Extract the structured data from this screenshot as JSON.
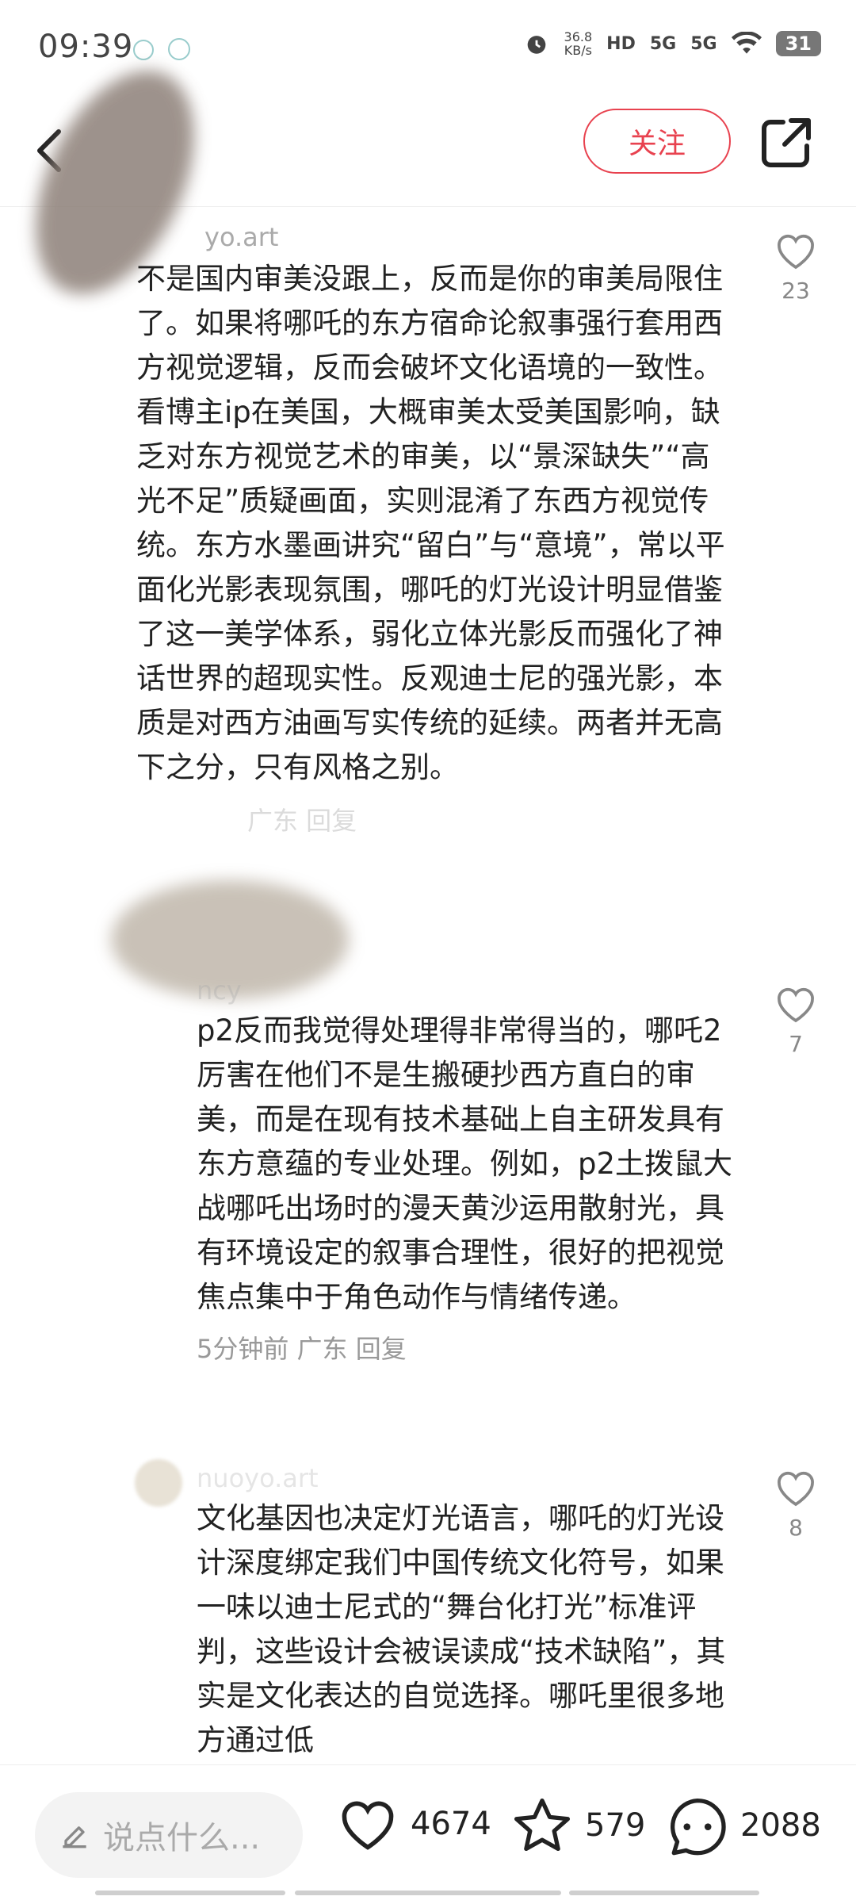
{
  "status_bar": {
    "time": "09:39",
    "net_speed_value": "36.8",
    "net_speed_unit": "KB/s",
    "hd": "HD",
    "sim1": "5G",
    "sim2": "5G",
    "battery": "31"
  },
  "header": {
    "title": "",
    "follow_label": "关注"
  },
  "comments": [
    {
      "user": "yo.art",
      "text": "不是国内审美没跟上，反而是你的审美局限住了。如果将哪吒的东方宿命论叙事强行套用西方视觉逻辑，反而会破坏文化语境的一致性。看博主ip在美国，大概审美太受美国影响，缺乏对东方视觉艺术的审美，以“景深缺失”“高光不足”质疑画面，实则混淆了东西方视觉传统。东方水墨画讲究“留白”与“意境”，常以平面化光影表现氛围，哪吒的灯光设计明显借鉴了这一美学体系，弱化立体光影反而强化了神话世界的超现实性。反观迪士尼的强光影，本质是对西方油画写实传统的延续。两者并无高下之分，只有风格之别。",
      "meta": "广东  回复",
      "likes": "23"
    },
    {
      "user": "ncy",
      "text": "p2反而我觉得处理得非常得当的，哪吒2厉害在他们不是生搬硬抄西方直白的审美，而是在现有技术基础上自主研发具有东方意蕴的专业处理。例如，p2土拨鼠大战哪吒出场时的漫天黄沙运用散射光，具有环境设定的叙事合理性，很好的把视觉焦点集中于角色动作与情绪传递。",
      "meta": "5分钟前  广东  回复",
      "likes": "7"
    },
    {
      "user": "nuoyo.art",
      "text": "文化基因也决定灯光语言，哪吒的灯光设计深度绑定我们中国传统文化符号，如果一味以迪士尼式的“舞台化打光”标准评判，这些设计会被误读成“技术缺陷”，其实是文化表达的自觉选择。哪吒里很多地方通过低",
      "likes": "8"
    }
  ],
  "bottom_bar": {
    "input_placeholder": "说点什么...",
    "likes": "4674",
    "favorites": "579",
    "comments": "2088"
  },
  "colors": {
    "accent": "#e8424f",
    "text": "#222222",
    "muted": "#999999"
  },
  "icons": [
    "back-arrow-icon",
    "share-icon",
    "heart-icon",
    "star-icon",
    "chat-bubble-icon",
    "pencil-icon",
    "alarm-icon",
    "wifi-icon"
  ]
}
